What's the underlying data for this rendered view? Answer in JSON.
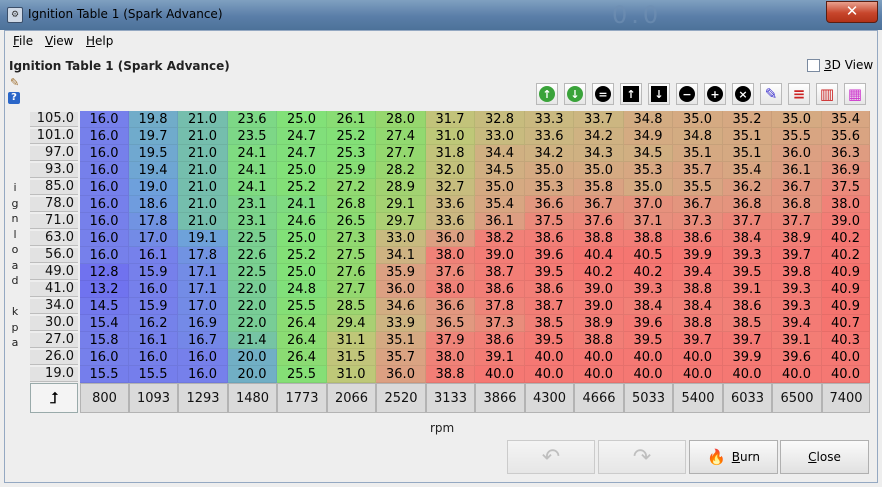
{
  "window": {
    "title": "Ignition Table 1 (Spark Advance)",
    "close_glyph": "✕",
    "background_text": "0.0"
  },
  "menu": [
    "File",
    "View",
    "Help"
  ],
  "header": {
    "label": "Ignition Table 1 (Spark Advance)",
    "view3d_label": "3D View",
    "view3d_checked": false
  },
  "toolbar": {
    "buttons": [
      {
        "name": "load-base-icon",
        "glyph": "↑",
        "color": "#3aa33a"
      },
      {
        "name": "save-base-icon",
        "glyph": "↓",
        "color": "#3aa33a"
      },
      {
        "name": "set-equal-icon",
        "glyph": "=",
        "color": "#000000"
      },
      {
        "name": "increment-icon",
        "glyph": "↑",
        "color": "#000000"
      },
      {
        "name": "decrement-icon",
        "glyph": "↓",
        "color": "#000000"
      },
      {
        "name": "subtract-icon",
        "glyph": "−",
        "color": "#000000"
      },
      {
        "name": "add-icon",
        "glyph": "+",
        "color": "#000000"
      },
      {
        "name": "multiply-icon",
        "glyph": "×",
        "color": "#000000"
      },
      {
        "name": "pen-icon",
        "glyph": "✎",
        "color": "#3b2fcf"
      },
      {
        "name": "interpolate-horizontal-icon",
        "glyph": "≡",
        "color": "#cc2222"
      },
      {
        "name": "interpolate-vertical-icon",
        "glyph": "▥",
        "color": "#cc2222"
      },
      {
        "name": "smooth-icon",
        "glyph": "▦",
        "color": "#cc33cc"
      }
    ]
  },
  "y_axis": {
    "label": [
      "i",
      "g",
      "n",
      "l",
      "o",
      "a",
      "d",
      "",
      "k",
      "p",
      "a"
    ],
    "values": [
      "105.0",
      "101.0",
      "97.0",
      "93.0",
      "85.0",
      "78.0",
      "71.0",
      "63.0",
      "56.0",
      "49.0",
      "41.0",
      "34.0",
      "30.0",
      "27.0",
      "26.0",
      "19.0"
    ]
  },
  "x_axis": {
    "label": "rpm",
    "corner_glyph": "⮥",
    "values": [
      "800",
      "1093",
      "1293",
      "1480",
      "1773",
      "2066",
      "2520",
      "3133",
      "3866",
      "4300",
      "4666",
      "5033",
      "5400",
      "6033",
      "6500",
      "7400"
    ]
  },
  "table": {
    "rows": [
      [
        "16.0",
        "19.8",
        "21.0",
        "23.6",
        "25.0",
        "26.1",
        "28.0",
        "31.7",
        "32.8",
        "33.3",
        "33.7",
        "34.8",
        "35.0",
        "35.2",
        "35.0",
        "35.4"
      ],
      [
        "16.0",
        "19.7",
        "21.0",
        "23.5",
        "24.7",
        "25.2",
        "27.4",
        "31.0",
        "33.0",
        "33.6",
        "34.2",
        "34.9",
        "34.8",
        "35.1",
        "35.5",
        "35.6"
      ],
      [
        "16.0",
        "19.5",
        "21.0",
        "24.1",
        "24.7",
        "25.3",
        "27.7",
        "31.8",
        "34.4",
        "34.2",
        "34.3",
        "34.5",
        "35.1",
        "35.1",
        "36.0",
        "36.3"
      ],
      [
        "16.0",
        "19.4",
        "21.0",
        "24.1",
        "25.0",
        "25.9",
        "28.2",
        "32.0",
        "34.5",
        "35.0",
        "35.0",
        "35.3",
        "35.7",
        "35.4",
        "36.1",
        "36.9"
      ],
      [
        "16.0",
        "19.0",
        "21.0",
        "24.1",
        "25.2",
        "27.2",
        "28.9",
        "32.7",
        "35.0",
        "35.3",
        "35.8",
        "35.0",
        "35.5",
        "36.2",
        "36.7",
        "37.5"
      ],
      [
        "16.0",
        "18.6",
        "21.0",
        "23.1",
        "24.1",
        "26.8",
        "29.1",
        "33.6",
        "35.4",
        "36.6",
        "36.7",
        "37.0",
        "36.7",
        "36.8",
        "36.8",
        "38.0"
      ],
      [
        "16.0",
        "17.8",
        "21.0",
        "23.1",
        "24.6",
        "26.5",
        "29.7",
        "33.6",
        "36.1",
        "37.5",
        "37.6",
        "37.1",
        "37.3",
        "37.7",
        "37.7",
        "39.0"
      ],
      [
        "16.0",
        "17.0",
        "19.1",
        "22.5",
        "25.0",
        "27.3",
        "33.0",
        "36.0",
        "38.2",
        "38.6",
        "38.8",
        "38.8",
        "38.6",
        "38.4",
        "38.9",
        "40.2"
      ],
      [
        "16.0",
        "16.1",
        "17.8",
        "22.6",
        "25.2",
        "27.5",
        "34.1",
        "38.0",
        "39.0",
        "39.6",
        "40.4",
        "40.5",
        "39.9",
        "39.3",
        "39.7",
        "40.2"
      ],
      [
        "12.8",
        "15.9",
        "17.1",
        "22.5",
        "25.0",
        "27.6",
        "35.9",
        "37.6",
        "38.7",
        "39.5",
        "40.2",
        "40.2",
        "39.4",
        "39.5",
        "39.8",
        "40.9"
      ],
      [
        "13.2",
        "16.0",
        "17.1",
        "22.0",
        "24.8",
        "27.7",
        "36.0",
        "38.0",
        "38.6",
        "38.6",
        "39.0",
        "39.3",
        "38.8",
        "39.1",
        "39.3",
        "40.9"
      ],
      [
        "14.5",
        "15.9",
        "17.0",
        "22.0",
        "25.5",
        "28.5",
        "34.6",
        "36.6",
        "37.8",
        "38.7",
        "39.0",
        "38.4",
        "38.4",
        "38.6",
        "39.3",
        "40.9"
      ],
      [
        "15.4",
        "16.2",
        "16.9",
        "22.0",
        "26.4",
        "29.4",
        "33.9",
        "36.5",
        "37.3",
        "38.5",
        "38.9",
        "39.6",
        "38.8",
        "38.5",
        "39.4",
        "40.7"
      ],
      [
        "15.8",
        "16.1",
        "16.7",
        "21.4",
        "26.4",
        "31.1",
        "35.1",
        "37.9",
        "38.6",
        "39.5",
        "38.8",
        "39.5",
        "39.7",
        "39.7",
        "39.1",
        "40.3"
      ],
      [
        "16.0",
        "16.0",
        "16.0",
        "20.0",
        "26.4",
        "31.5",
        "35.7",
        "38.0",
        "39.1",
        "40.0",
        "40.0",
        "40.0",
        "40.0",
        "39.9",
        "39.6",
        "40.0"
      ],
      [
        "15.5",
        "15.5",
        "16.0",
        "20.0",
        "25.5",
        "31.0",
        "36.0",
        "38.8",
        "40.0",
        "40.0",
        "40.0",
        "40.0",
        "40.0",
        "40.0",
        "40.0",
        "40.0"
      ]
    ]
  },
  "footer": {
    "undo_glyph": "↶",
    "redo_glyph": "↷",
    "burn_label": "Burn",
    "burn_icon": "🔥",
    "close_label": "Close"
  }
}
